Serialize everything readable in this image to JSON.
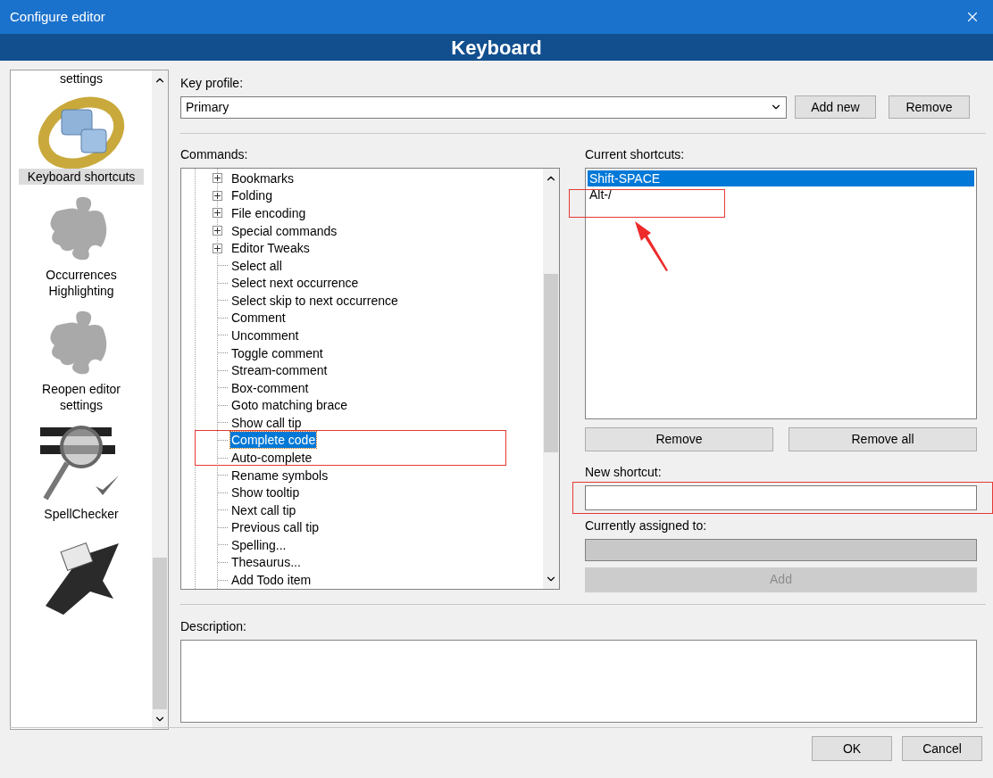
{
  "window": {
    "title": "Configure editor"
  },
  "header": {
    "title": "Keyboard"
  },
  "sidebar": {
    "items": [
      {
        "label": "settings",
        "kind": "cut",
        "selected": false
      },
      {
        "label": "Keyboard shortcuts",
        "kind": "ring",
        "selected": true
      },
      {
        "label": "Occurrences Highlighting",
        "kind": "puzzle",
        "selected": false
      },
      {
        "label": "Reopen editor settings",
        "kind": "puzzle",
        "selected": false
      },
      {
        "label": "SpellChecker",
        "kind": "spell",
        "selected": false
      },
      {
        "kind": "tool",
        "selected": false
      }
    ]
  },
  "key_profile": {
    "label": "Key profile:",
    "value": "Primary",
    "buttons": [
      "Add new",
      "Remove"
    ]
  },
  "commands": {
    "label": "Commands:",
    "items": [
      {
        "label": "Bookmarks",
        "kind": "group",
        "expanded": false,
        "selected": false
      },
      {
        "label": "Folding",
        "kind": "group",
        "expanded": false,
        "selected": false
      },
      {
        "label": "File encoding",
        "kind": "group",
        "expanded": false,
        "selected": false
      },
      {
        "label": "Special commands",
        "kind": "group",
        "expanded": false,
        "selected": false
      },
      {
        "label": "Editor Tweaks",
        "kind": "group",
        "expanded": false,
        "selected": false
      },
      {
        "label": "Select all",
        "kind": "command",
        "selected": false
      },
      {
        "label": "Select next occurrence",
        "kind": "command",
        "selected": false
      },
      {
        "label": "Select skip to next occurrence",
        "kind": "command",
        "selected": false
      },
      {
        "label": "Comment",
        "kind": "command",
        "selected": false
      },
      {
        "label": "Uncomment",
        "kind": "command",
        "selected": false
      },
      {
        "label": "Toggle comment",
        "kind": "command",
        "selected": false
      },
      {
        "label": "Stream-comment",
        "kind": "command",
        "selected": false
      },
      {
        "label": "Box-comment",
        "kind": "command",
        "selected": false
      },
      {
        "label": "Goto matching brace",
        "kind": "command",
        "selected": false
      },
      {
        "label": "Show call tip",
        "kind": "command",
        "selected": false
      },
      {
        "label": "Complete code",
        "kind": "command",
        "selected": true
      },
      {
        "label": "Auto-complete",
        "kind": "command",
        "selected": false
      },
      {
        "label": "Rename symbols",
        "kind": "command",
        "selected": false
      },
      {
        "label": "Show tooltip",
        "kind": "command",
        "selected": false
      },
      {
        "label": "Next call tip",
        "kind": "command",
        "selected": false
      },
      {
        "label": "Previous call tip",
        "kind": "command",
        "selected": false
      },
      {
        "label": "Spelling...",
        "kind": "command",
        "selected": false
      },
      {
        "label": "Thesaurus...",
        "kind": "command",
        "selected": false
      },
      {
        "label": "Add Todo item",
        "kind": "command",
        "selected": false
      }
    ]
  },
  "current_shortcuts": {
    "label": "Current shortcuts:",
    "items": [
      {
        "label": "Shift-SPACE",
        "selected": true
      },
      {
        "label": "Alt-/",
        "selected": false
      }
    ],
    "buttons": [
      "Remove",
      "Remove all"
    ]
  },
  "new_shortcut": {
    "label": "New shortcut:"
  },
  "currently_assigned": {
    "label": "Currently assigned to:"
  },
  "add_button": {
    "label": "Add",
    "disabled": true
  },
  "description": {
    "label": "Description:"
  },
  "footer": {
    "buttons": [
      "OK",
      "Cancel"
    ]
  },
  "annotations": [
    {
      "kind": "box"
    },
    {
      "kind": "box"
    },
    {
      "kind": "arrow"
    },
    {
      "kind": "box"
    }
  ]
}
